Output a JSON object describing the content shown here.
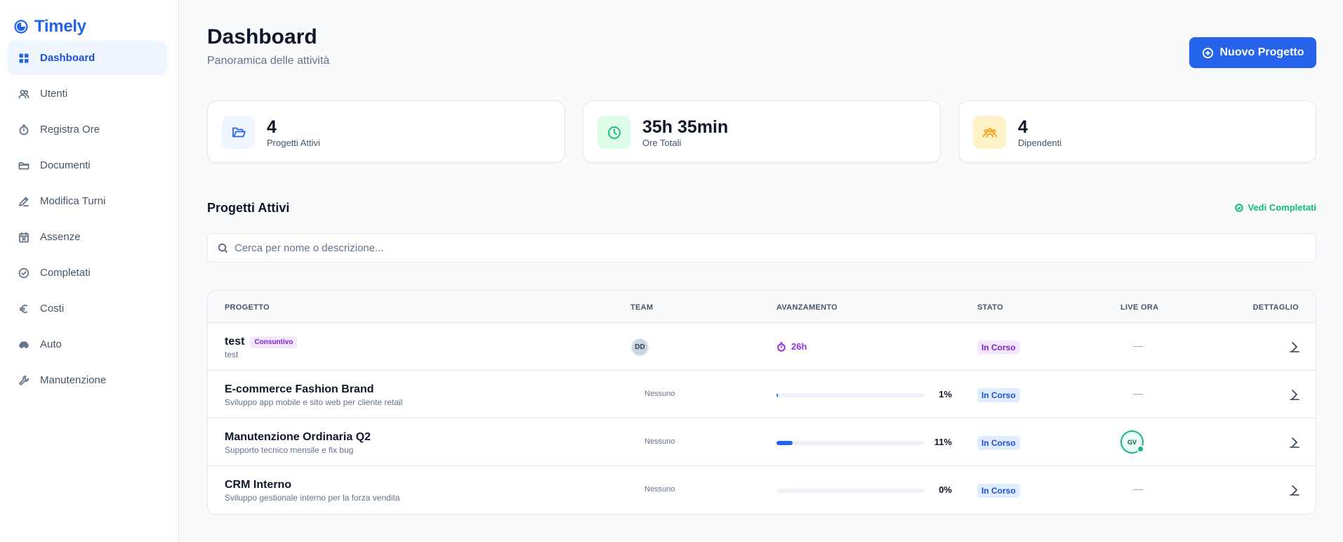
{
  "app": {
    "name": "Timely"
  },
  "sidebar": {
    "items": [
      {
        "label": "Dashboard",
        "icon": "grid-icon",
        "active": true
      },
      {
        "label": "Utenti",
        "icon": "users-icon"
      },
      {
        "label": "Registra Ore",
        "icon": "stopwatch-icon"
      },
      {
        "label": "Documenti",
        "icon": "folder-icon"
      },
      {
        "label": "Modifica Turni",
        "icon": "pencil-icon"
      },
      {
        "label": "Assenze",
        "icon": "calendar-x-icon"
      },
      {
        "label": "Completati",
        "icon": "check-circle-icon"
      },
      {
        "label": "Costi",
        "icon": "euro-icon"
      },
      {
        "label": "Auto",
        "icon": "car-icon"
      },
      {
        "label": "Manutenzione",
        "icon": "wrench-icon"
      }
    ]
  },
  "header": {
    "title": "Dashboard",
    "subtitle": "Panoramica delle attività",
    "new_project_label": "Nuovo Progetto"
  },
  "stats": [
    {
      "value": "4",
      "label": "Progetti Attivi",
      "icon": "folder-open-icon",
      "color": "#2563eb"
    },
    {
      "value": "35h 35min",
      "label": "Ore Totali",
      "icon": "clock-icon",
      "color": "#10b981"
    },
    {
      "value": "4",
      "label": "Dipendenti",
      "icon": "team-icon",
      "color": "#f59e0b"
    }
  ],
  "projects_section": {
    "title": "Progetti Attivi",
    "completed_link": "Vedi Completati",
    "search_placeholder": "Cerca per nome o descrizione..."
  },
  "table": {
    "headers": {
      "project": "PROGETTO",
      "team": "TEAM",
      "progress": "AVANZAMENTO",
      "status": "STATO",
      "live": "LIVE ORA",
      "detail": "DETTAGLIO"
    },
    "rows": [
      {
        "name": "test",
        "tag": "Consuntivo",
        "description": "test",
        "team": "DD",
        "hours": "26h",
        "status": "In Corso",
        "live": "—"
      },
      {
        "name": "E-commerce Fashion Brand",
        "description": "Sviluppo app mobile e sito web per cliente retail",
        "team_none": "Nessuno",
        "progress": 0.01,
        "progress_label": "1%",
        "status": "In Corso",
        "live": "—"
      },
      {
        "name": "Manutenzione Ordinaria Q2",
        "description": "Supporto tecnico mensile e fix bug",
        "team_none": "Nessuno",
        "progress": 0.11,
        "progress_label": "11%",
        "status": "In Corso",
        "live_user": "GV"
      },
      {
        "name": "CRM Interno",
        "description": "Sviluppo gestionale interno per la forza vendita",
        "team_none": "Nessuno",
        "progress": 0.0,
        "progress_label": "0%",
        "status": "In Corso",
        "live": "—"
      }
    ]
  }
}
